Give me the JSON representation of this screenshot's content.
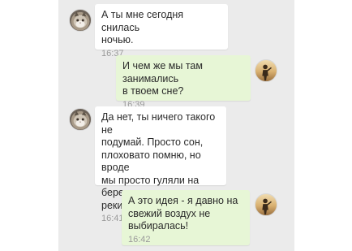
{
  "messages": [
    {
      "id": "m1",
      "direction": "incoming",
      "text": "А ты мне сегодня снилась\nночью.",
      "time": "16:37",
      "avatar": "cat-avatar"
    },
    {
      "id": "m2",
      "direction": "outgoing",
      "text": "И чем же мы там занимались\nв твоем сне?",
      "time": "16:39",
      "avatar": "person-silhouette-avatar"
    },
    {
      "id": "m3",
      "direction": "incoming",
      "text": "Да нет, ты ничего такого не\nподумай. Просто сон,\nплоховато помню, но вроде\nмы просто гуляли на берегу\nреки.",
      "time": "16:41",
      "avatar": "cat-avatar"
    },
    {
      "id": "m4",
      "direction": "outgoing",
      "text": "А это идея - я давно на\nсвежий воздух не\nвыбиралась!",
      "time": "16:42",
      "avatar": "person-silhouette-avatar"
    }
  ],
  "colors": {
    "chat_background": "#ebebeb",
    "incoming_bubble": "#ffffff",
    "outgoing_bubble": "#e7f6d6",
    "time_text": "#9a9a9a"
  }
}
